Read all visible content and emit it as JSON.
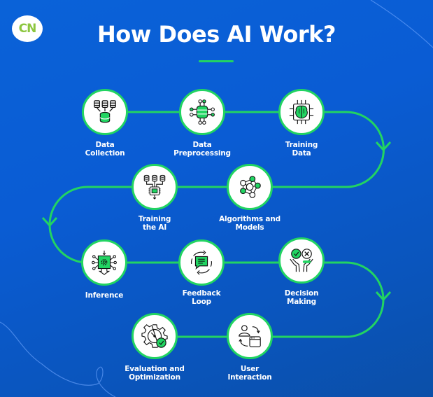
{
  "logo": {
    "text": "CN",
    "color": "#8cc63f"
  },
  "title": "How Does AI Work?",
  "colors": {
    "accent": "#22d462",
    "background": "#0a5cd4",
    "node_fill": "#ffffff",
    "text": "#ffffff"
  },
  "steps": [
    {
      "line1": "Data",
      "line2": "Collection",
      "icon": "database-collection-icon"
    },
    {
      "line1": "Data",
      "line2": "Preprocessing",
      "icon": "database-network-icon"
    },
    {
      "line1": "Training",
      "line2": "Data",
      "icon": "brain-chip-icon"
    },
    {
      "line1": "Algorithms and",
      "line2": "Models",
      "icon": "neural-network-icon"
    },
    {
      "line1": "Training",
      "line2": "the AI",
      "icon": "chip-databases-icon"
    },
    {
      "line1": "Inference",
      "line2": "",
      "icon": "processor-gear-icon"
    },
    {
      "line1": "Feedback",
      "line2": "Loop",
      "icon": "chat-cycle-icon"
    },
    {
      "line1": "Decision",
      "line2": "Making",
      "icon": "hands-check-cross-icon"
    },
    {
      "line1": "User",
      "line2": "Interaction",
      "icon": "user-window-cycle-icon"
    },
    {
      "line1": "Evaluation and",
      "line2": "Optimization",
      "icon": "gear-gauge-check-icon"
    }
  ]
}
